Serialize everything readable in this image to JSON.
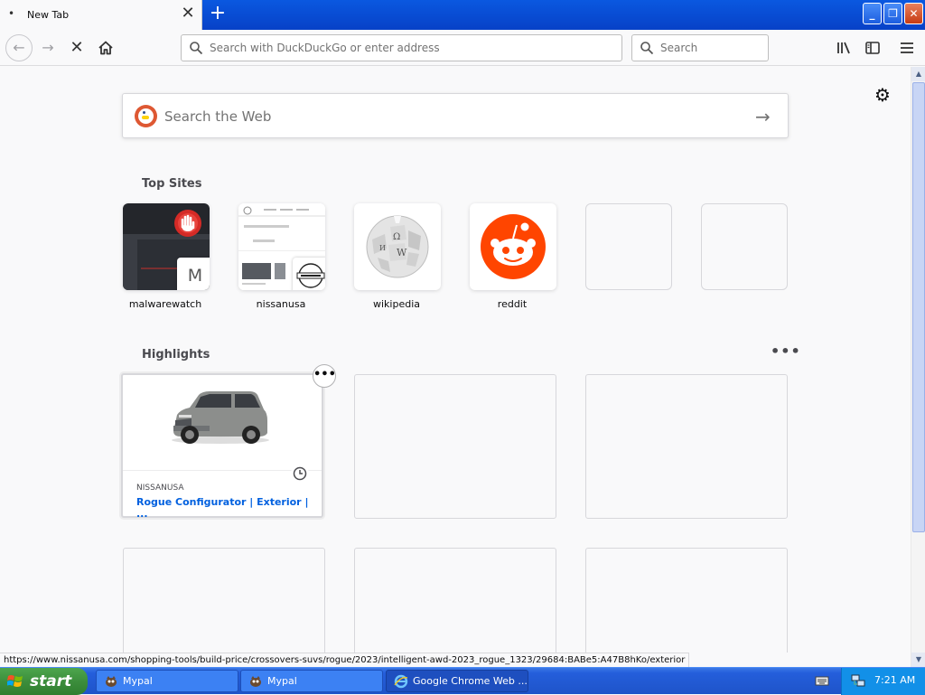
{
  "browser": {
    "tab": {
      "title": "New Tab",
      "bullet": "•",
      "close": "✕"
    },
    "new_tab": "+",
    "window_buttons": {
      "minimize": "_",
      "maximize": "❐",
      "close": "✕"
    },
    "urlbar": {
      "placeholder": "Search with DuckDuckGo or enter address"
    },
    "searchbar": {
      "placeholder": "Search"
    },
    "nav": {
      "back": "←",
      "forward": "→",
      "stop": "✕",
      "home": "⌂",
      "library": "|||\\",
      "sidebar": "◫",
      "menu": "≡"
    }
  },
  "newtab": {
    "gear": "⚙",
    "web_search": {
      "placeholder": "Search the Web",
      "arrow": "→"
    },
    "top_sites": {
      "title": "Top Sites",
      "items": [
        {
          "label": "malwarewatch",
          "badge": "M"
        },
        {
          "label": "nissanusa"
        },
        {
          "label": "wikipedia"
        },
        {
          "label": "reddit"
        }
      ]
    },
    "highlights": {
      "title": "Highlights",
      "more": "•••",
      "cards": [
        {
          "source": "NISSANUSA",
          "title": "Rogue Configurator | Exterior | ..."
        }
      ]
    }
  },
  "status_url": "https://www.nissanusa.com/shopping-tools/build-price/crossovers-suvs/rogue/2023/intelligent-awd-2023_rogue_1323/29684:BABe5:A47B8hKo/exterior",
  "taskbar": {
    "start": "start",
    "tasks": [
      {
        "label": "Mypal"
      },
      {
        "label": "Mypal"
      },
      {
        "label": "Google Chrome Web ..."
      }
    ],
    "clock": "7:21 AM"
  },
  "colors": {
    "taskbar": "#245edb",
    "start": "#3c8e3c",
    "link": "#0060df",
    "reddit": "#ff4500"
  }
}
